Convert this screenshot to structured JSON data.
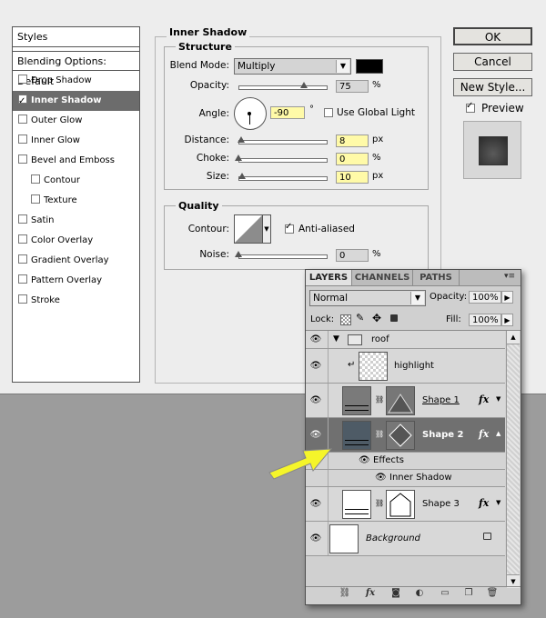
{
  "styles_panel": {
    "header": "Styles",
    "blending": "Blending Options: Default",
    "items": [
      {
        "label": "Drop Shadow",
        "checked": false,
        "selected": false,
        "indent": false
      },
      {
        "label": "Inner Shadow",
        "checked": true,
        "selected": true,
        "indent": false
      },
      {
        "label": "Outer Glow",
        "checked": false,
        "selected": false,
        "indent": false
      },
      {
        "label": "Inner Glow",
        "checked": false,
        "selected": false,
        "indent": false
      },
      {
        "label": "Bevel and Emboss",
        "checked": false,
        "selected": false,
        "indent": false
      },
      {
        "label": "Contour",
        "checked": false,
        "selected": false,
        "indent": true
      },
      {
        "label": "Texture",
        "checked": false,
        "selected": false,
        "indent": true
      },
      {
        "label": "Satin",
        "checked": false,
        "selected": false,
        "indent": false
      },
      {
        "label": "Color Overlay",
        "checked": false,
        "selected": false,
        "indent": false
      },
      {
        "label": "Gradient Overlay",
        "checked": false,
        "selected": false,
        "indent": false
      },
      {
        "label": "Pattern Overlay",
        "checked": false,
        "selected": false,
        "indent": false
      },
      {
        "label": "Stroke",
        "checked": false,
        "selected": false,
        "indent": false
      }
    ]
  },
  "inner_shadow": {
    "title": "Inner Shadow",
    "structure_title": "Structure",
    "blend_mode_label": "Blend Mode:",
    "blend_mode_value": "Multiply",
    "shadow_color": "#000000",
    "opacity_label": "Opacity:",
    "opacity_value": "75",
    "opacity_unit": "%",
    "opacity_level": 0.75,
    "angle_label": "Angle:",
    "angle_value": "-90",
    "angle_unit": "°",
    "use_global_light_label": "Use Global Light",
    "use_global_light": false,
    "distance_label": "Distance:",
    "distance_value": "8",
    "distance_unit": "px",
    "distance_level": 0.03,
    "choke_label": "Choke:",
    "choke_value": "0",
    "choke_unit": "%",
    "choke_level": 0,
    "size_label": "Size:",
    "size_value": "10",
    "size_unit": "px",
    "size_level": 0.04,
    "quality_title": "Quality",
    "contour_label": "Contour:",
    "anti_aliased_label": "Anti-aliased",
    "anti_aliased": true,
    "noise_label": "Noise:",
    "noise_value": "0",
    "noise_unit": "%",
    "noise_level": 0
  },
  "buttons": {
    "ok": "OK",
    "cancel": "Cancel",
    "new_style": "New Style...",
    "preview_label": "Preview",
    "preview_checked": true
  },
  "layers_panel": {
    "tabs": [
      "LAYERS",
      "CHANNELS",
      "PATHS"
    ],
    "active_tab": "LAYERS",
    "blend_mode": "Normal",
    "opacity_label": "Opacity:",
    "opacity_value": "100%",
    "lock_label": "Lock:",
    "fill_label": "Fill:",
    "fill_value": "100%",
    "layers": [
      {
        "name": "roof",
        "kind": "group"
      },
      {
        "name": "highlight",
        "kind": "clipped"
      },
      {
        "name": "Shape 1",
        "kind": "shape",
        "fx": "fx"
      },
      {
        "name": "Shape 2",
        "kind": "shape",
        "fx": "fx",
        "selected": true
      },
      {
        "name": "Effects",
        "kind": "effects-header"
      },
      {
        "name": "Inner Shadow",
        "kind": "effect"
      },
      {
        "name": "Shape 3",
        "kind": "shape",
        "fx": "fx"
      },
      {
        "name": "Background",
        "kind": "background"
      }
    ]
  },
  "colors": {
    "selection": "#707070",
    "arrow": "#f5f52a",
    "dialog_bg": "#ededed"
  }
}
